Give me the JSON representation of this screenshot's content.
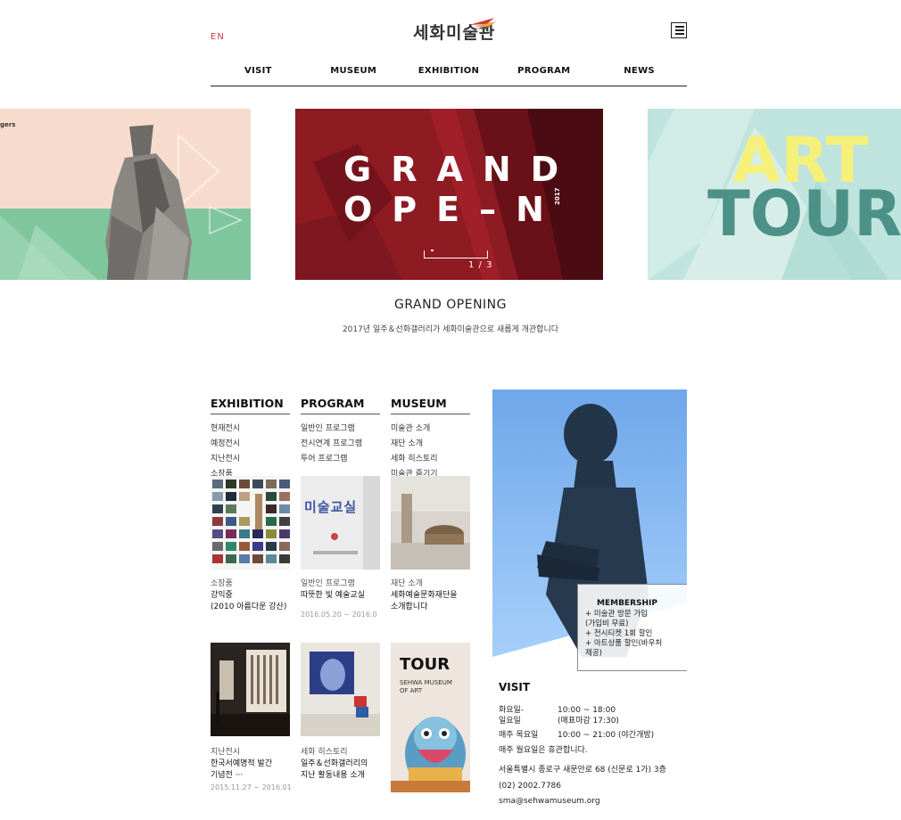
{
  "header": {
    "lang": "EN",
    "logo": "세화미술관",
    "nav": [
      "VISIT",
      "MUSEUM",
      "EXHIBITION",
      "PROGRAM",
      "NEWS"
    ]
  },
  "slider": {
    "left_label": "gers",
    "main_word_line1": "GRAND",
    "main_word_line2": "OPE–N",
    "main_year": "2017",
    "pager": "1 / 3",
    "right_word_line1": "ART",
    "right_word_line2": "TOUR",
    "title": "GRAND OPENING",
    "desc": "2017년 일주＆선화갤러리가 세화미술관으로 새롭게 개관합니다"
  },
  "columns": {
    "exhibition": {
      "title": "EXHIBITION",
      "items": [
        "현재전시",
        "예정전시",
        "지난전시",
        "소장품"
      ]
    },
    "program": {
      "title": "PROGRAM",
      "items": [
        "일반인 프로그램",
        "전시연계 프로그램",
        "투어 프로그램"
      ]
    },
    "museum": {
      "title": "MUSEUM",
      "items": [
        "미술관 소개",
        "재단 소개",
        "세화 히스토리",
        "미술관 즐기기"
      ]
    }
  },
  "cards": [
    {
      "cat": "소장품",
      "title1": "강익중",
      "title2": "(2010 아름다운 강산)",
      "date": ""
    },
    {
      "cat": "일반인 프로그램",
      "title1": "따뜻한 빛 예술교실",
      "title2": "",
      "date": "2016.05.20 ~ 2016.0"
    },
    {
      "cat": "재단 소개",
      "title1": "세화예술문화재단을",
      "title2": "소개합니다",
      "date": ""
    },
    {
      "cat": "지난전시",
      "title1": "한국서예명적 발간",
      "title2": "기념전 ···",
      "date": "2015.11.27 ~ 2016.01"
    },
    {
      "cat": "세화 히스토리",
      "title1": "일주＆선화갤러리의",
      "title2": "지난 활동내용 소개",
      "date": ""
    }
  ],
  "tour_card": {
    "title": "TOUR",
    "sub1": "SEHWA MUSEUM",
    "sub2": "OF ART"
  },
  "classroom_sign": "미술교실",
  "membership": {
    "title": "MEMBERSHIP",
    "items": [
      "+  미술관 방문 가입",
      "(가입비 무료)",
      "+  전시티켓 1회 할인",
      "+  아트상품 할인(바우처",
      "제공)"
    ]
  },
  "visit": {
    "title": "VISIT",
    "rows": [
      {
        "day": "화요일-",
        "time": "10:00 ~ 18:00"
      },
      {
        "day": "일요일",
        "time": "(매표마감 17:30)"
      },
      {
        "day": "매주 목요일",
        "time": "10:00 ~ 21:00 (야간개방)"
      }
    ],
    "closed": "매주 월요일은 휴관합니다.",
    "address": "서울특별시 종로구 새문안로 68 (신문로 1가) 3층",
    "phone": "(02) 2002.7786",
    "email": "sma@sehwamuseum.org"
  },
  "colors": {
    "accent_red": "#d23a3a",
    "slide_red": "#8e1a22",
    "slide_mint": "#bfe4de",
    "sky_blue": "#7fb7ef"
  }
}
